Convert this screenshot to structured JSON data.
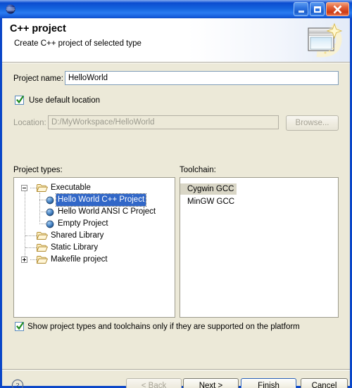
{
  "window": {
    "app_icon": "eclipse-sphere-icon",
    "buttons": {
      "minimize": "minimize-icon",
      "maximize": "maximize-icon",
      "close": "close-icon"
    }
  },
  "header": {
    "title": "C++ project",
    "subtitle": "Create C++ project of selected type",
    "icon": "new-project-wizard-icon"
  },
  "form": {
    "project_name_label": "Project name:",
    "project_name_value": "HelloWorld",
    "use_default_location_label": "Use default location",
    "use_default_location_checked": true,
    "location_label": "Location:",
    "location_value": "D:/MyWorkspace/HelloWorld",
    "browse_label": "Browse...",
    "browse_enabled": false
  },
  "project_types": {
    "label": "Project types:",
    "nodes": [
      {
        "label": "Executable",
        "type": "folder",
        "level": 0,
        "expander": "minus"
      },
      {
        "label": "Hello World C++ Project",
        "type": "leaf",
        "level": 1,
        "selected": true
      },
      {
        "label": "Hello World ANSI C Project",
        "type": "leaf",
        "level": 1,
        "selected": false
      },
      {
        "label": "Empty Project",
        "type": "leaf",
        "level": 1,
        "selected": false
      },
      {
        "label": "Shared Library",
        "type": "folder",
        "level": 0,
        "expander": "none"
      },
      {
        "label": "Static Library",
        "type": "folder",
        "level": 0,
        "expander": "none"
      },
      {
        "label": "Makefile project",
        "type": "folder",
        "level": 0,
        "expander": "plus"
      }
    ]
  },
  "toolchain": {
    "label": "Toolchain:",
    "items": [
      {
        "label": "Cygwin GCC",
        "selected": true
      },
      {
        "label": "MinGW GCC",
        "selected": false
      }
    ]
  },
  "options": {
    "show_supported_label": "Show project types and toolchains only if they are supported on the platform",
    "show_supported_checked": true
  },
  "footer": {
    "help_icon": "help-question-icon",
    "back_label": "< Back",
    "back_enabled": false,
    "next_label_pre": "N",
    "next_label_post": "ext >",
    "finish_label_pre": "F",
    "finish_label_post": "inish",
    "cancel_label": "Cancel"
  },
  "colors": {
    "dialog_bg": "#ECE9D8",
    "title_blue": "#0C4ED0",
    "selection_blue": "#3167C8",
    "field_border": "#7F9DB9",
    "disabled_text": "#9B9A8E"
  }
}
